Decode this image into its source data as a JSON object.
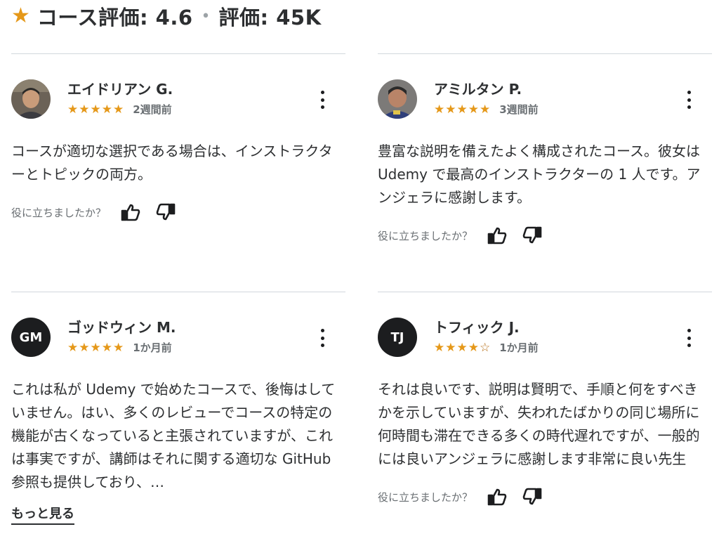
{
  "header": {
    "rating_label": "コース評価: 4.6",
    "count_label": "評価: 45K",
    "separator": "•",
    "star_color": "#e59819"
  },
  "helpful_prompt": "役に立ちましたか？",
  "see_more_label": "もっと見る",
  "reviews": [
    {
      "name": "エイドリアン G.",
      "rating": 5,
      "stars": "★★★★★",
      "time": "2週間前",
      "avatar": "photo",
      "content": "コースが適切な選択である場合は、インストラクターとトピックの両方。"
    },
    {
      "name": "アミルタン P.",
      "rating": 5,
      "stars": "★★★★★",
      "time": "3週間前",
      "avatar": "photo",
      "content": "豊富な説明を備えたよく構成されたコース。彼女は Udemy で最高のインストラクターの 1 人です。アンジェラに感謝します。"
    },
    {
      "name": "ゴッドウィン M.",
      "rating": 5,
      "stars": "★★★★★",
      "time": "1か月前",
      "avatar_initials": "GM",
      "content": "これは私が Udemy で始めたコースで、後悔はしていません。はい、多くのレビューでコースの特定の機能が古くなっていると主張されていますが、これは事実ですが、講師はそれに関する適切な GitHub 参照も提供しており、…"
    },
    {
      "name": "トフィック J.",
      "rating": 4,
      "stars": "★★★★",
      "stars_empty": "☆",
      "time": "1か月前",
      "avatar_initials": "TJ",
      "content": "それは良いです、説明は賢明で、手順と何をすべきかを示していますが、失われたばかりの同じ場所に何時間も滞在できる多くの時代遅れですが、一般的には良いアンジェラに感謝します非常に良い先生"
    }
  ]
}
